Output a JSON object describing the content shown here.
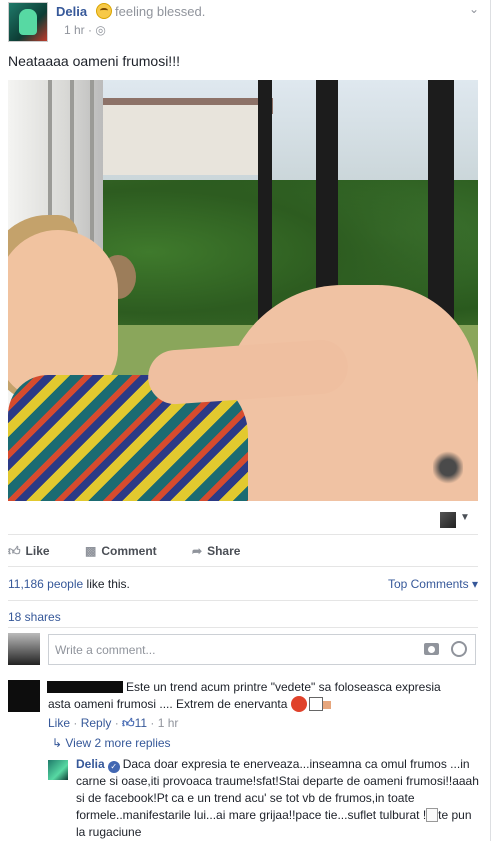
{
  "post": {
    "author": "Delia",
    "feeling": "feeling blessed.",
    "time": "1 hr ·",
    "text": "Neataaaa oameni frumosi!!!"
  },
  "actions": {
    "like": "Like",
    "comment": "Comment",
    "share": "Share"
  },
  "stats": {
    "likes_count": "11,186 people",
    "likes_suffix": " like this.",
    "top_comments": "Top Comments ▾",
    "shares": "18 shares"
  },
  "comment_box": {
    "placeholder": "Write a comment..."
  },
  "comments": [
    {
      "text_line1": "Este un trend acum printre \"vedete\" sa foloseasca expresia",
      "text_line2": "asta oameni frumosi .... Extrem de enervanta",
      "like": "Like",
      "sep1": " · ",
      "reply": "Reply",
      "sep2": " · ",
      "likes": "11",
      "time": " · 1 hr"
    }
  ],
  "replies_link": "↳ View 2 more replies",
  "reply": {
    "author": "Delia",
    "text": "Daca doar expresia te enerveaza...inseamna ca omul frumos ...in carne si oase,iti provoaca traume!sfat!Stai departe de oameni frumosi!!aaah si de facebook!Pt ca e un trend acu' se tot vb de frumos,in toate formele..manifestarile lui...ai mare grijaa!!pace tie...suflet tulburat !",
    "tail": "te pun la rugaciune"
  },
  "icons": {
    "globe": "globe-icon",
    "chevron": "chevron-down-icon",
    "like": "thumbs-up-icon",
    "comment": "comment-icon",
    "share": "share-arrow-icon",
    "camera": "camera-icon",
    "emoji": "smiley-icon"
  },
  "colors": {
    "link": "#365899",
    "meta": "#90949c",
    "accent": "#4267b2"
  }
}
